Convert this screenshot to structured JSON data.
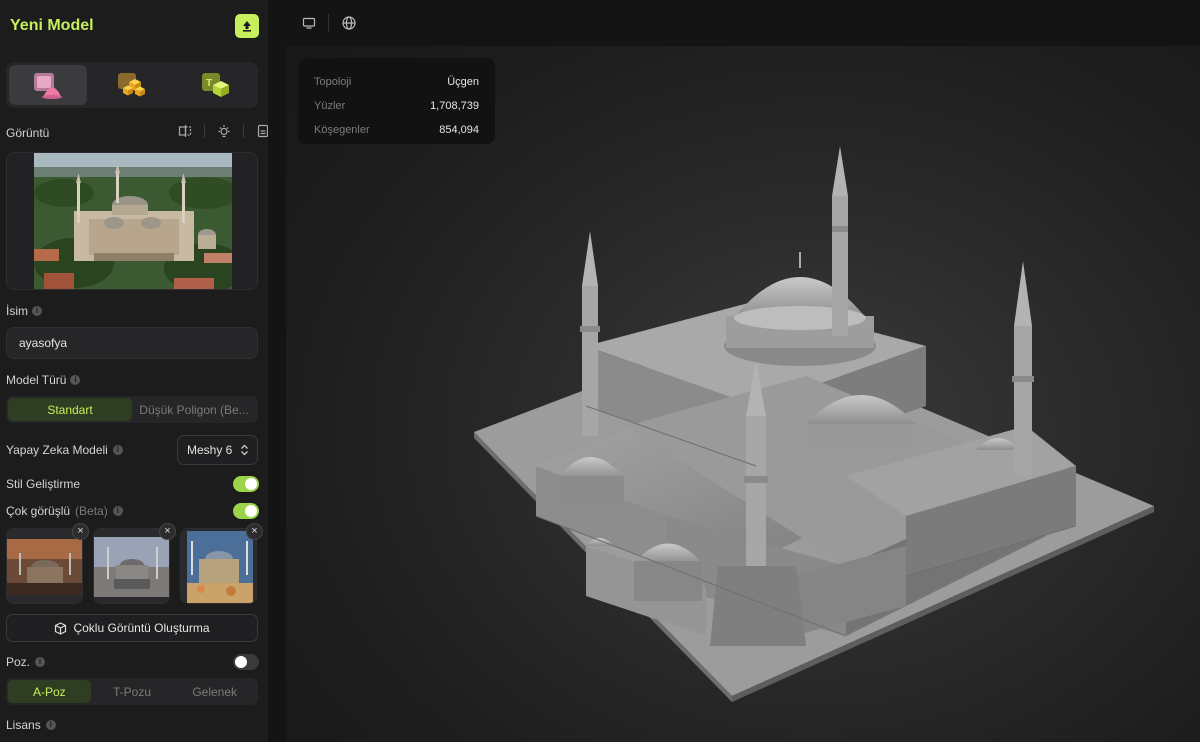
{
  "sidebar": {
    "title": "Yeni Model",
    "image_section": {
      "label": "Görüntü"
    },
    "name_section": {
      "label": "İsim",
      "value": "ayasofya"
    },
    "model_type": {
      "label": "Model Türü",
      "options": [
        "Standart",
        "Düşük Poligon (Be..."
      ],
      "selected": "Standart"
    },
    "ai_model": {
      "label": "Yapay Zeka Modeli",
      "value": "Meshy 6"
    },
    "style": {
      "label": "Stil Geliştirme",
      "enabled": true
    },
    "multiview": {
      "label": "Çok görüşlü",
      "badge": "(Beta)",
      "enabled": true
    },
    "multiview_button": "Çoklu Görüntü Oluşturma",
    "pose": {
      "label": "Poz.",
      "enabled": false,
      "options": [
        "A-Poz",
        "T-Pozu",
        "Gelenek"
      ],
      "selected": "A-Poz"
    },
    "license": {
      "label": "Lisans"
    }
  },
  "stats": [
    {
      "key": "Topoloji",
      "value": "Üçgen"
    },
    {
      "key": "Yüzler",
      "value": "1,708,739"
    },
    {
      "key": "Köşegenler",
      "value": "854,094"
    }
  ],
  "colors": {
    "accent": "#c6ef5c",
    "toggle_on": "#9bd44a",
    "background": "#1c1c1d"
  },
  "icons": [
    "upload-icon",
    "image-to-3d-icon",
    "multi-image-icon",
    "text-to-3d-icon",
    "compare-icon",
    "light-icon",
    "document-icon",
    "cube-icon",
    "monitor-icon",
    "globe-icon",
    "info-icon",
    "chevron-updown-icon",
    "close-icon"
  ]
}
